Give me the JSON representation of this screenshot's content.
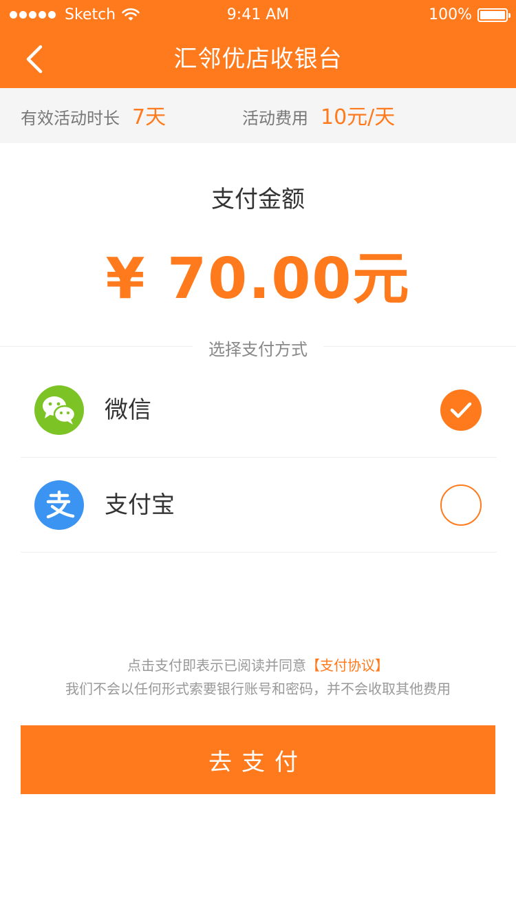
{
  "status_bar": {
    "carrier": "Sketch",
    "time": "9:41 AM",
    "battery": "100%"
  },
  "nav": {
    "title": "汇邻优店收银台"
  },
  "info": {
    "duration_label": "有效活动时长",
    "duration_value": "7天",
    "fee_label": "活动费用",
    "fee_value": "10元/天"
  },
  "payment": {
    "amount_label": "支付金额",
    "amount": "¥ 70.00元",
    "method_title": "选择支付方式",
    "methods": [
      {
        "name": "微信",
        "icon": "wechat-icon",
        "selected": true
      },
      {
        "name": "支付宝",
        "icon": "alipay-icon",
        "selected": false
      }
    ]
  },
  "agreement": {
    "text": "点击支付即表示已阅读并同意",
    "link": "【支付协议】",
    "note": "我们不会以任何形式索要银行账号和密码，并不会收取其他费用"
  },
  "pay_button": "去支付",
  "colors": {
    "accent": "#ff7a1c",
    "wechat": "#7cc325",
    "alipay": "#3b93f2"
  }
}
